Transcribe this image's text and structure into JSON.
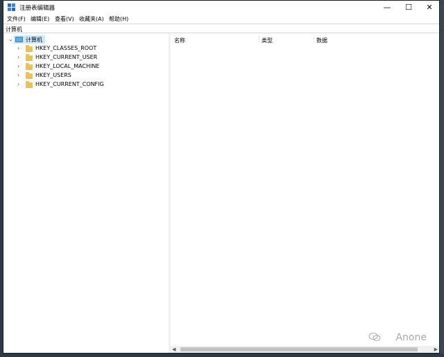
{
  "window": {
    "title": "注册表编辑器",
    "minimize_glyph": "—",
    "maximize_glyph": "☐",
    "close_glyph": "✕"
  },
  "menu": [
    "文件(F)",
    "编辑(E)",
    "查看(V)",
    "收藏夹(A)",
    "帮助(H)"
  ],
  "address": "计算机",
  "tree": {
    "root": {
      "label": "计算机",
      "icon": "computer-icon",
      "expanded": true,
      "selected": true
    },
    "children": [
      {
        "label": "HKEY_CLASSES_ROOT",
        "icon": "folder-icon"
      },
      {
        "label": "HKEY_CURRENT_USER",
        "icon": "folder-icon"
      },
      {
        "label": "HKEY_LOCAL_MACHINE",
        "icon": "folder-icon"
      },
      {
        "label": "HKEY_USERS",
        "icon": "folder-icon"
      },
      {
        "label": "HKEY_CURRENT_CONFIG",
        "icon": "folder-icon"
      }
    ]
  },
  "list": {
    "columns": [
      "名称",
      "类型",
      "数据"
    ]
  },
  "watermark": "Anone",
  "colors": {
    "selection": "#cce8ff",
    "folder": "#e8c25a",
    "desktop": "#1e2a32"
  }
}
